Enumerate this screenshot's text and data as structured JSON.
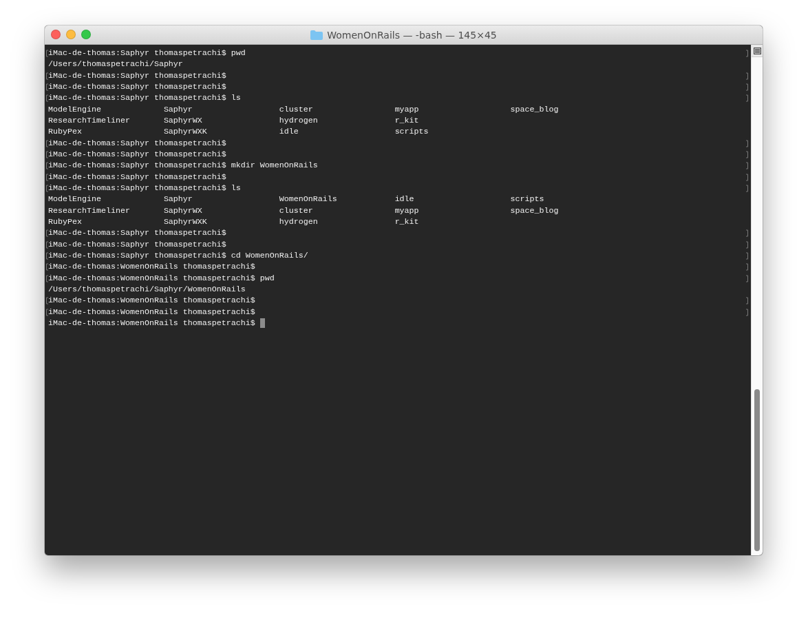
{
  "window": {
    "title": "WomenOnRails — -bash — 145×45"
  },
  "lines": [
    {
      "kind": "prompt",
      "text": "iMac-de-thomas:Saphyr thomaspetrachi$ pwd",
      "marked": true
    },
    {
      "kind": "output",
      "text": "/Users/thomaspetrachi/Saphyr"
    },
    {
      "kind": "prompt",
      "text": "iMac-de-thomas:Saphyr thomaspetrachi$",
      "marked": true
    },
    {
      "kind": "prompt",
      "text": "iMac-de-thomas:Saphyr thomaspetrachi$",
      "marked": true
    },
    {
      "kind": "prompt",
      "text": "iMac-de-thomas:Saphyr thomaspetrachi$ ls",
      "marked": true
    },
    {
      "kind": "columns",
      "cells": [
        "ModelEngine",
        "Saphyr",
        "cluster",
        "myapp",
        "space_blog"
      ]
    },
    {
      "kind": "columns",
      "cells": [
        "ResearchTimeliner",
        "SaphyrWX",
        "hydrogen",
        "r_kit"
      ]
    },
    {
      "kind": "columns",
      "cells": [
        "RubyPex",
        "SaphyrWXK",
        "idle",
        "scripts"
      ]
    },
    {
      "kind": "prompt",
      "text": "iMac-de-thomas:Saphyr thomaspetrachi$",
      "marked": true
    },
    {
      "kind": "prompt",
      "text": "iMac-de-thomas:Saphyr thomaspetrachi$",
      "marked": true
    },
    {
      "kind": "prompt",
      "text": "iMac-de-thomas:Saphyr thomaspetrachi$ mkdir WomenOnRails",
      "marked": true
    },
    {
      "kind": "prompt",
      "text": "iMac-de-thomas:Saphyr thomaspetrachi$",
      "marked": true
    },
    {
      "kind": "prompt",
      "text": "iMac-de-thomas:Saphyr thomaspetrachi$ ls",
      "marked": true
    },
    {
      "kind": "columns",
      "cells": [
        "ModelEngine",
        "Saphyr",
        "WomenOnRails",
        "idle",
        "scripts"
      ]
    },
    {
      "kind": "columns",
      "cells": [
        "ResearchTimeliner",
        "SaphyrWX",
        "cluster",
        "myapp",
        "space_blog"
      ]
    },
    {
      "kind": "columns",
      "cells": [
        "RubyPex",
        "SaphyrWXK",
        "hydrogen",
        "r_kit"
      ]
    },
    {
      "kind": "prompt",
      "text": "iMac-de-thomas:Saphyr thomaspetrachi$",
      "marked": true
    },
    {
      "kind": "prompt",
      "text": "iMac-de-thomas:Saphyr thomaspetrachi$",
      "marked": true
    },
    {
      "kind": "prompt",
      "text": "iMac-de-thomas:Saphyr thomaspetrachi$ cd WomenOnRails/",
      "marked": true
    },
    {
      "kind": "prompt",
      "text": "iMac-de-thomas:WomenOnRails thomaspetrachi$",
      "marked": true
    },
    {
      "kind": "prompt",
      "text": "iMac-de-thomas:WomenOnRails thomaspetrachi$ pwd",
      "marked": true
    },
    {
      "kind": "output",
      "text": "/Users/thomaspetrachi/Saphyr/WomenOnRails"
    },
    {
      "kind": "prompt",
      "text": "iMac-de-thomas:WomenOnRails thomaspetrachi$",
      "marked": true
    },
    {
      "kind": "prompt",
      "text": "iMac-de-thomas:WomenOnRails thomaspetrachi$",
      "marked": true
    },
    {
      "kind": "prompt",
      "text": "iMac-de-thomas:WomenOnRails thomaspetrachi$",
      "marked": false,
      "cursor": true
    }
  ]
}
